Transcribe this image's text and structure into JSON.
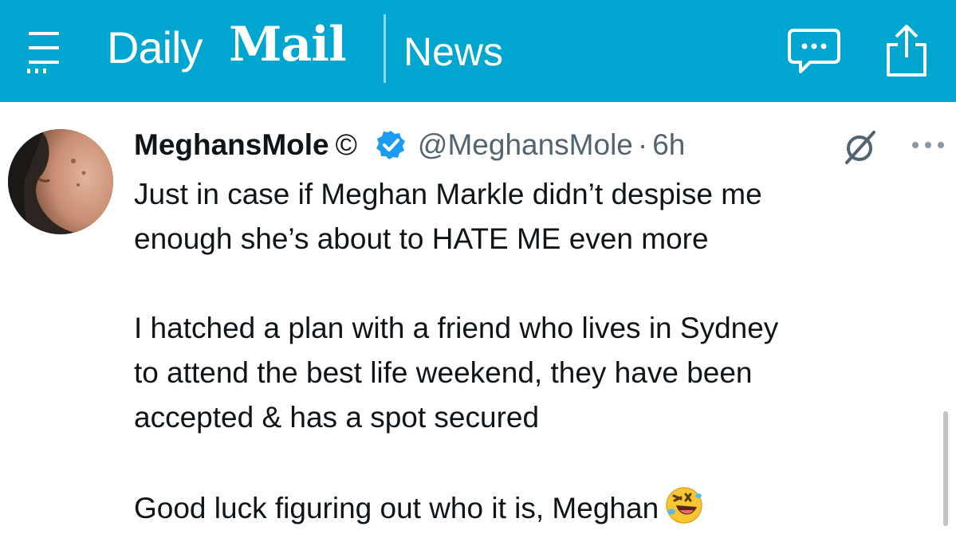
{
  "header": {
    "brand_daily": "Daily",
    "brand_mail": "Mail",
    "section": "News",
    "menu_icon": "hamburger-menu-icon",
    "comment_icon": "comment-bubble-icon",
    "share_icon": "share-icon",
    "background_color": "#00a6cf"
  },
  "tweet": {
    "display_name": "MeghansMole",
    "copyright_symbol": "©",
    "verified_icon": "verified-badge-icon",
    "verified_color": "#1d9bf0",
    "handle": "@MeghansMole",
    "separator": "·",
    "time": "6h",
    "grok_icon": "grok-slash-icon",
    "more_icon": "more-dots-icon",
    "paragraph_1_line_1": "Just in case if Meghan Markle didn’t despise me",
    "paragraph_1_line_2": "enough she’s about to HATE ME even more",
    "paragraph_2_line_1": "I hatched a plan with a friend who lives in Sydney",
    "paragraph_2_line_2": "to attend the best life weekend, they have been",
    "paragraph_2_line_3": "accepted & has a spot secured",
    "paragraph_3": "Good luck figuring out who it is, Meghan",
    "emoji": "rolling-on-floor-laughing-emoji"
  }
}
